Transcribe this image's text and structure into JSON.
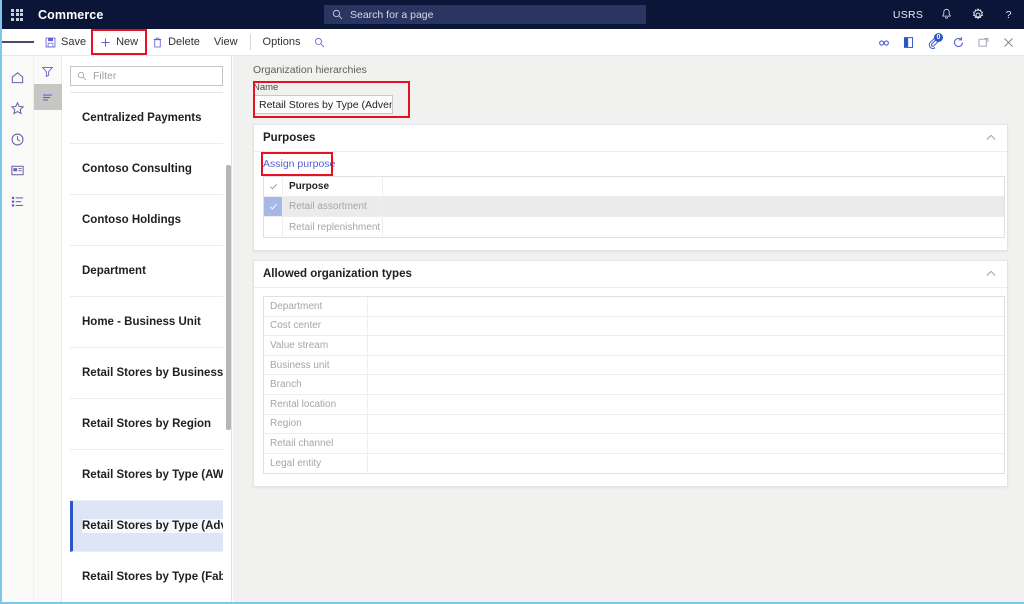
{
  "topbar": {
    "brand": "Commerce",
    "waffle_icon": "app-launcher-icon",
    "search": {
      "placeholder": "Search for a page",
      "icon": "search-icon"
    },
    "user_initials": "USRS",
    "notifications_icon": "bell-icon",
    "settings_icon": "gear-icon",
    "help_icon": "help-icon",
    "help_glyph": "?"
  },
  "commandbar": {
    "menu_icon": "hamburger-icon",
    "items": [
      {
        "label": "Save",
        "icon": "save-icon",
        "highlighted": false
      },
      {
        "label": "New",
        "icon": "plus-icon",
        "highlighted": true
      },
      {
        "label": "Delete",
        "icon": "trash-icon",
        "highlighted": false
      },
      {
        "label": "View",
        "icon": "",
        "highlighted": false
      },
      {
        "label": "Options",
        "icon": "",
        "highlighted": false
      }
    ],
    "search_icon": "search-icon",
    "right_icons": [
      {
        "name": "share-link-icon"
      },
      {
        "name": "office-app-icon"
      },
      {
        "name": "attachments-icon",
        "badge": "0"
      },
      {
        "name": "refresh-icon"
      },
      {
        "name": "popout-icon"
      },
      {
        "name": "close-icon"
      }
    ]
  },
  "rail": {
    "items": [
      {
        "name": "home-icon"
      },
      {
        "name": "favorites-star-icon"
      },
      {
        "name": "recent-clock-icon"
      },
      {
        "name": "workspaces-icon"
      },
      {
        "name": "modules-list-icon"
      }
    ]
  },
  "filter_strip": {
    "items": [
      {
        "name": "filter-funnel-icon",
        "selected": false
      },
      {
        "name": "sort-list-icon",
        "selected": true
      }
    ]
  },
  "list_panel": {
    "filter": {
      "placeholder": "Filter",
      "icon": "search-icon"
    },
    "items": [
      {
        "label": "Centralized Payments",
        "selected": false
      },
      {
        "label": "Contoso Consulting",
        "selected": false
      },
      {
        "label": "Contoso Holdings",
        "selected": false
      },
      {
        "label": "Department",
        "selected": false
      },
      {
        "label": "Home - Business Unit",
        "selected": false
      },
      {
        "label": "Retail Stores by Business Unit",
        "selected": false
      },
      {
        "label": "Retail Stores by Region",
        "selected": false
      },
      {
        "label": "Retail Stores by Type (AW)",
        "selected": false
      },
      {
        "label": "Retail Stores by Type (Advent",
        "selected": true
      },
      {
        "label": "Retail Stores by Type (Fabrik..",
        "selected": false
      }
    ]
  },
  "content": {
    "breadcrumb": "Organization hierarchies",
    "name_field": {
      "label": "Name",
      "value": "Retail Stores by Type (Adventur..."
    },
    "purposes_card": {
      "title": "Purposes",
      "collapse_icon": "chevron-up-icon",
      "assign_link": "Assign purpose",
      "columns": [
        "",
        "Purpose"
      ],
      "header_check_icon": "check-icon",
      "rows": [
        {
          "label": "Retail assortment",
          "checked": true,
          "selected": true
        },
        {
          "label": "Retail replenishment",
          "checked": false,
          "selected": false
        }
      ]
    },
    "allowed_types_card": {
      "title": "Allowed organization types",
      "collapse_icon": "chevron-up-icon",
      "rows": [
        "Department",
        "Cost center",
        "Value stream",
        "Business unit",
        "Branch",
        "Rental location",
        "Region",
        "Retail channel",
        "Legal entity"
      ]
    }
  },
  "annotations": {
    "highlight_color": "#e81123",
    "boxes": [
      "new-button",
      "name-field",
      "assign-purpose-link"
    ]
  }
}
